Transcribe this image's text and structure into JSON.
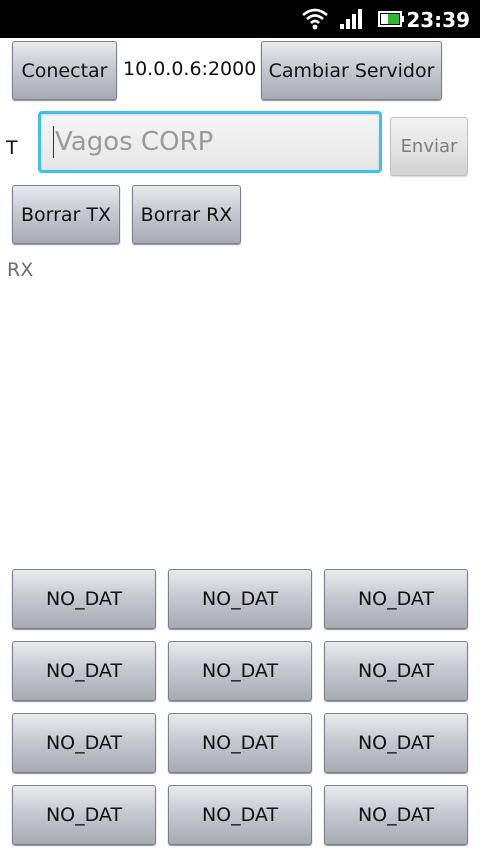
{
  "status_bar": {
    "time": "23:39",
    "icons": [
      "wifi-icon",
      "signal-icon",
      "battery-icon"
    ]
  },
  "connection": {
    "connect_label": "Conectar",
    "server_address": "10.0.0.6:2000",
    "change_server_label": "Cambiar Servidor"
  },
  "tx": {
    "label": "T",
    "input_value": "",
    "input_placeholder": "Vagos CORP",
    "send_label": "Enviar"
  },
  "actions": {
    "clear_tx_label": "Borrar TX",
    "clear_rx_label": "Borrar RX"
  },
  "rx": {
    "label": "RX",
    "content": ""
  },
  "data_buttons": [
    [
      "NO_DAT",
      "NO_DAT",
      "NO_DAT"
    ],
    [
      "NO_DAT",
      "NO_DAT",
      "NO_DAT"
    ],
    [
      "NO_DAT",
      "NO_DAT",
      "NO_DAT"
    ],
    [
      "NO_DAT",
      "NO_DAT",
      "NO_DAT"
    ]
  ],
  "colors": {
    "status_bar_bg": "#000000",
    "input_focus_border": "#3ec1ea",
    "button_gradient_top": "#e9eaec",
    "button_gradient_bottom": "#a6abb3"
  }
}
